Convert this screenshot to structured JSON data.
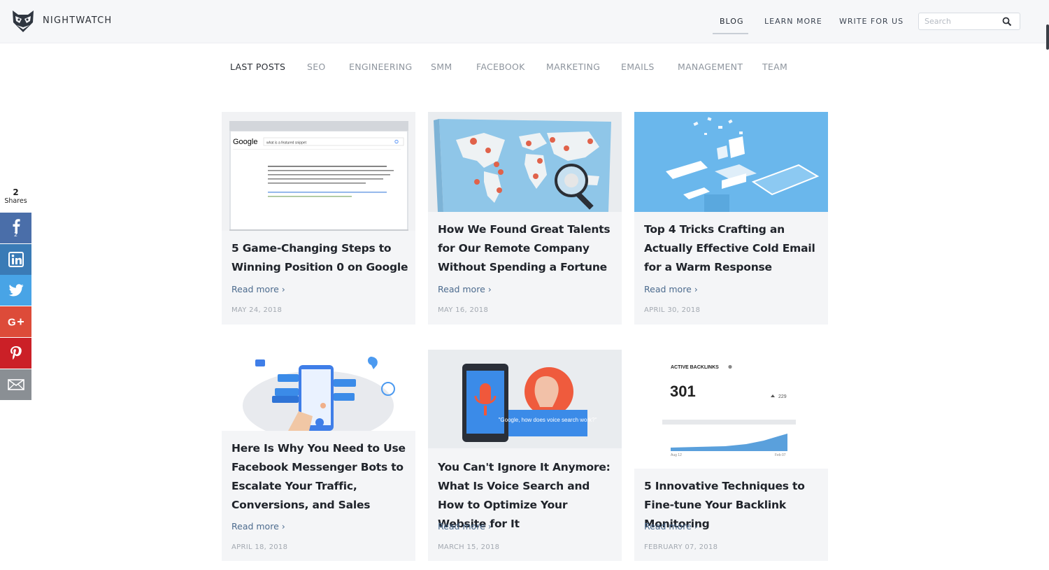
{
  "brand": {
    "name": "NIGHTWATCH",
    "logo_icon": "owl-logo-icon"
  },
  "topnav": [
    {
      "label": "BLOG",
      "active": true
    },
    {
      "label": "LEARN MORE",
      "active": false
    },
    {
      "label": "WRITE FOR US",
      "active": false
    }
  ],
  "search": {
    "placeholder": "Search",
    "icon": "search-icon"
  },
  "categories": [
    {
      "label": "LAST POSTS",
      "active": true
    },
    {
      "label": "SEO"
    },
    {
      "label": "ENGINEERING"
    },
    {
      "label": "SMM"
    },
    {
      "label": "FACEBOOK"
    },
    {
      "label": "MARKETING"
    },
    {
      "label": "EMAILS"
    },
    {
      "label": "MANAGEMENT"
    },
    {
      "label": "TEAM"
    }
  ],
  "share": {
    "count": "2",
    "label": "Shares",
    "buttons": [
      {
        "network": "facebook",
        "icon": "facebook-icon",
        "count": "2",
        "color": "#4a6ea9"
      },
      {
        "network": "linkedin",
        "icon": "linkedin-icon",
        "color": "#3a7bb6"
      },
      {
        "network": "twitter",
        "icon": "twitter-icon",
        "color": "#48a4e6"
      },
      {
        "network": "google-plus",
        "icon": "google-plus-icon",
        "color": "#dd4b39"
      },
      {
        "network": "pinterest",
        "icon": "pinterest-icon",
        "color": "#cb2027"
      },
      {
        "network": "email",
        "icon": "mail-icon",
        "color": "#8a8f94"
      }
    ]
  },
  "posts": [
    {
      "title": "5 Game-Changing Steps to Winning Position 0 on Google",
      "read_more": "Read more ›",
      "date": "MAY 24, 2018",
      "thumb": {
        "search_text": "what is a featured snippet",
        "google": "Google"
      }
    },
    {
      "title": "How We Found Great Talents for Our Remote Company Without Spending a Fortune",
      "read_more": "Read more ›",
      "date": "MAY 16, 2018"
    },
    {
      "title": "Top 4 Tricks Crafting an Actually Effective Cold Email for a Warm Response",
      "read_more": "Read more ›",
      "date": "APRIL 30, 2018"
    },
    {
      "title": "Here Is Why You Need to Use Facebook Messenger Bots to Escalate Your Traffic, Conversions, and Sales",
      "read_more": "Read more ›",
      "date": "APRIL 18, 2018"
    },
    {
      "title": "You Can't Ignore It Anymore: What Is Voice Search and How to Optimize Your Website for It",
      "read_more": "Read more ›",
      "date": "MARCH 15, 2018",
      "thumb": {
        "bubble": "\"Google, how does voice search work?\""
      }
    },
    {
      "title": "5 Innovative Techniques to Fine-tune Your Backlink Monitoring",
      "read_more": "Read more ›",
      "date": "FEBRUARY 07, 2018",
      "thumb": {
        "label": "ACTIVE BACKLINKS",
        "value": "301",
        "delta": "229",
        "start": "Aug 12",
        "end": "Feb 07"
      }
    }
  ],
  "colors": {
    "accent_link": "#4c6b8e",
    "card_bg": "#f4f5f7",
    "header_bg": "#f6f7f9"
  }
}
